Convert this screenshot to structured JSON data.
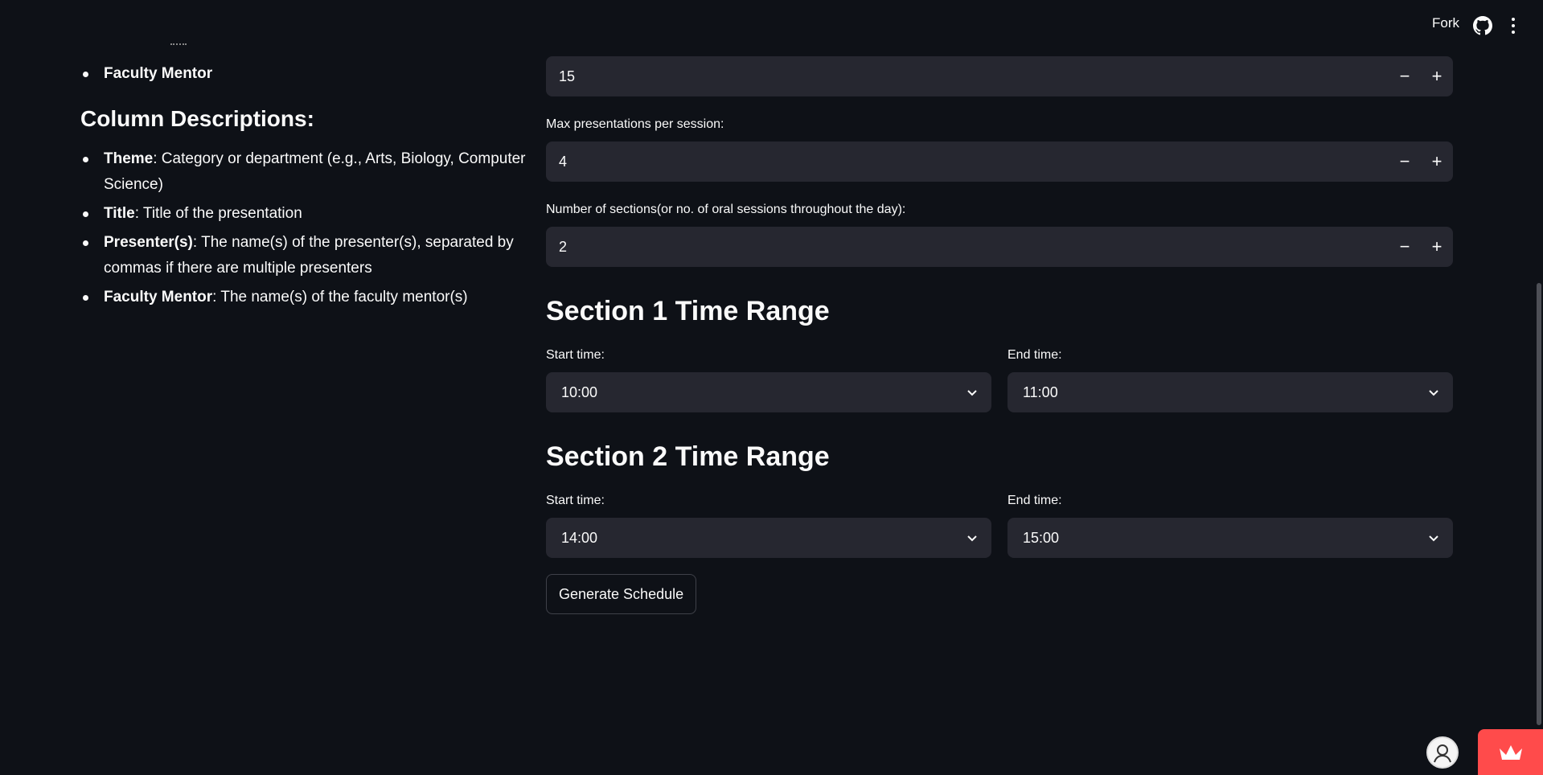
{
  "header": {
    "fork_label": "Fork",
    "github_icon": "github-icon",
    "menu_icon": "kebab-menu-icon"
  },
  "left": {
    "top_list": [
      "Faculty Mentor"
    ],
    "column_heading": "Column Descriptions:",
    "descriptions": [
      {
        "term": "Theme",
        "text": ": Category or department (e.g., Arts, Biology, Computer Science)"
      },
      {
        "term": "Title",
        "text": ": Title of the presentation"
      },
      {
        "term": "Presenter(s)",
        "text": ": The name(s) of the presenter(s), separated by commas if there are multiple presenters"
      },
      {
        "term": "Faculty Mentor",
        "text": ": The name(s) of the faculty mentor(s)"
      }
    ]
  },
  "inputs": {
    "first": {
      "value": "15",
      "minus": "−",
      "plus": "+"
    },
    "max_presentations": {
      "label": "Max presentations per session:",
      "value": "4",
      "minus": "−",
      "plus": "+"
    },
    "num_sections": {
      "label": "Number of sections(or no. of oral sessions throughout the day):",
      "value": "2",
      "minus": "−",
      "plus": "+"
    }
  },
  "sections": [
    {
      "title": "Section 1 Time Range",
      "start_label": "Start time:",
      "start_value": "10:00",
      "end_label": "End time:",
      "end_value": "11:00"
    },
    {
      "title": "Section 2 Time Range",
      "start_label": "Start time:",
      "start_value": "14:00",
      "end_label": "End time:",
      "end_value": "15:00"
    }
  ],
  "generate_button": "Generate Schedule",
  "colors": {
    "background": "#0e1117",
    "input_bg": "#262730",
    "accent": "#ff4b4b"
  }
}
